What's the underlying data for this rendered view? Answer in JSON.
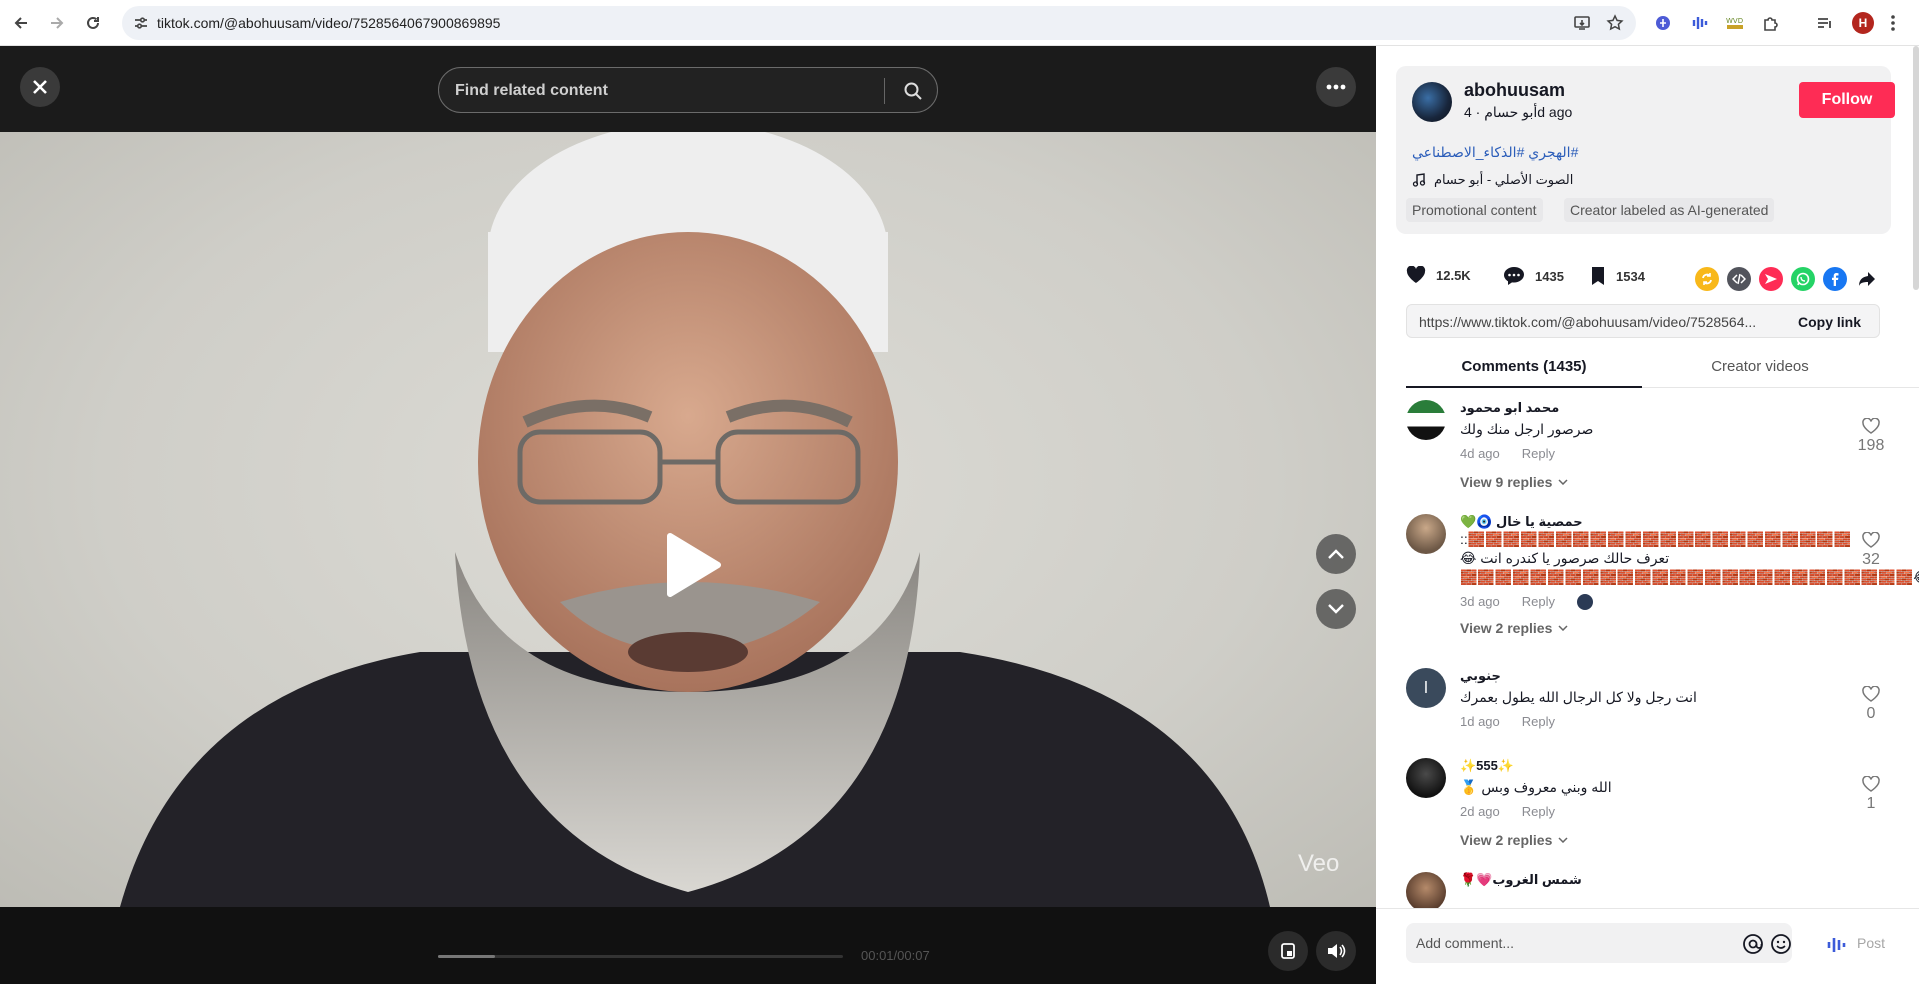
{
  "browser": {
    "url": "tiktok.com/@abohuusam/video/7528564067900869895",
    "profile_initial": "H",
    "icons": [
      "back-icon",
      "forward-icon",
      "reload-icon",
      "site-info-icon",
      "install-icon",
      "bookmark-star-icon",
      "extension-icons",
      "extensions-puzzle-icon",
      "media-control-icon",
      "menu-dots-icon"
    ]
  },
  "player": {
    "search_placeholder": "Find related content",
    "watermark": "Veo",
    "time": "00:01/00:07",
    "progress": 0.14
  },
  "post": {
    "username": "abohuusam",
    "nickname": "أبو حسام",
    "posted": "4d ago",
    "follow_label": "Follow",
    "hashtags": "#الهجري #الذكاء_الاصطناعي",
    "music": "الصوت الأصلي - أبو حسام",
    "label_promo": "Promotional content",
    "label_ai": "Creator labeled as AI-generated",
    "likes": "12.5K",
    "comments": "1435",
    "saves": "1534",
    "link": "https://www.tiktok.com/@abohuusam/video/7528564...",
    "copy_label": "Copy link",
    "share_colors": {
      "repost": "#f8b81a",
      "embed": "#52545c",
      "send": "#fe2c55",
      "whatsapp": "#25d366",
      "facebook": "#1877f2"
    }
  },
  "tabs": {
    "comments": "Comments (1435)",
    "creator": "Creator videos"
  },
  "comments": [
    {
      "name": "محمد ابو محمود",
      "text": "صرصور ارجل منك ولك",
      "time": "4d ago",
      "reply": "Reply",
      "likes": "198",
      "view_replies": "View 9 replies"
    },
    {
      "name": "حمصية يا خال 🧿💚",
      "line1": "::🧱🧱🧱🧱🧱🧱🧱🧱🧱🧱🧱🧱🧱🧱🧱🧱🧱🧱🧱🧱🧱🧱",
      "line2": "تعرف حالك صرصور يا كندره انت 😂",
      "line3": "🧱🧱🧱🧱🧱🧱🧱🧱🧱🧱🧱🧱🧱🧱🧱🧱🧱🧱🧱🧱🧱🧱🧱🧱🧱🧱😂",
      "time": "3d ago",
      "reply": "Reply",
      "likes": "32",
      "view_replies": "View 2 replies"
    },
    {
      "name": "جنوبي",
      "initial": "ا",
      "text": "انت رجل ولا كل الرجال الله يطول بعمرك",
      "time": "1d ago",
      "reply": "Reply",
      "likes": "0"
    },
    {
      "name": "✨555✨",
      "text": "الله وبني معروف وبس 🥇",
      "time": "2d ago",
      "reply": "Reply",
      "likes": "1",
      "view_replies": "View 2 replies"
    },
    {
      "name": "شمس الغروب💗🌹"
    }
  ],
  "composer": {
    "placeholder": "Add comment...",
    "post_label": "Post"
  }
}
